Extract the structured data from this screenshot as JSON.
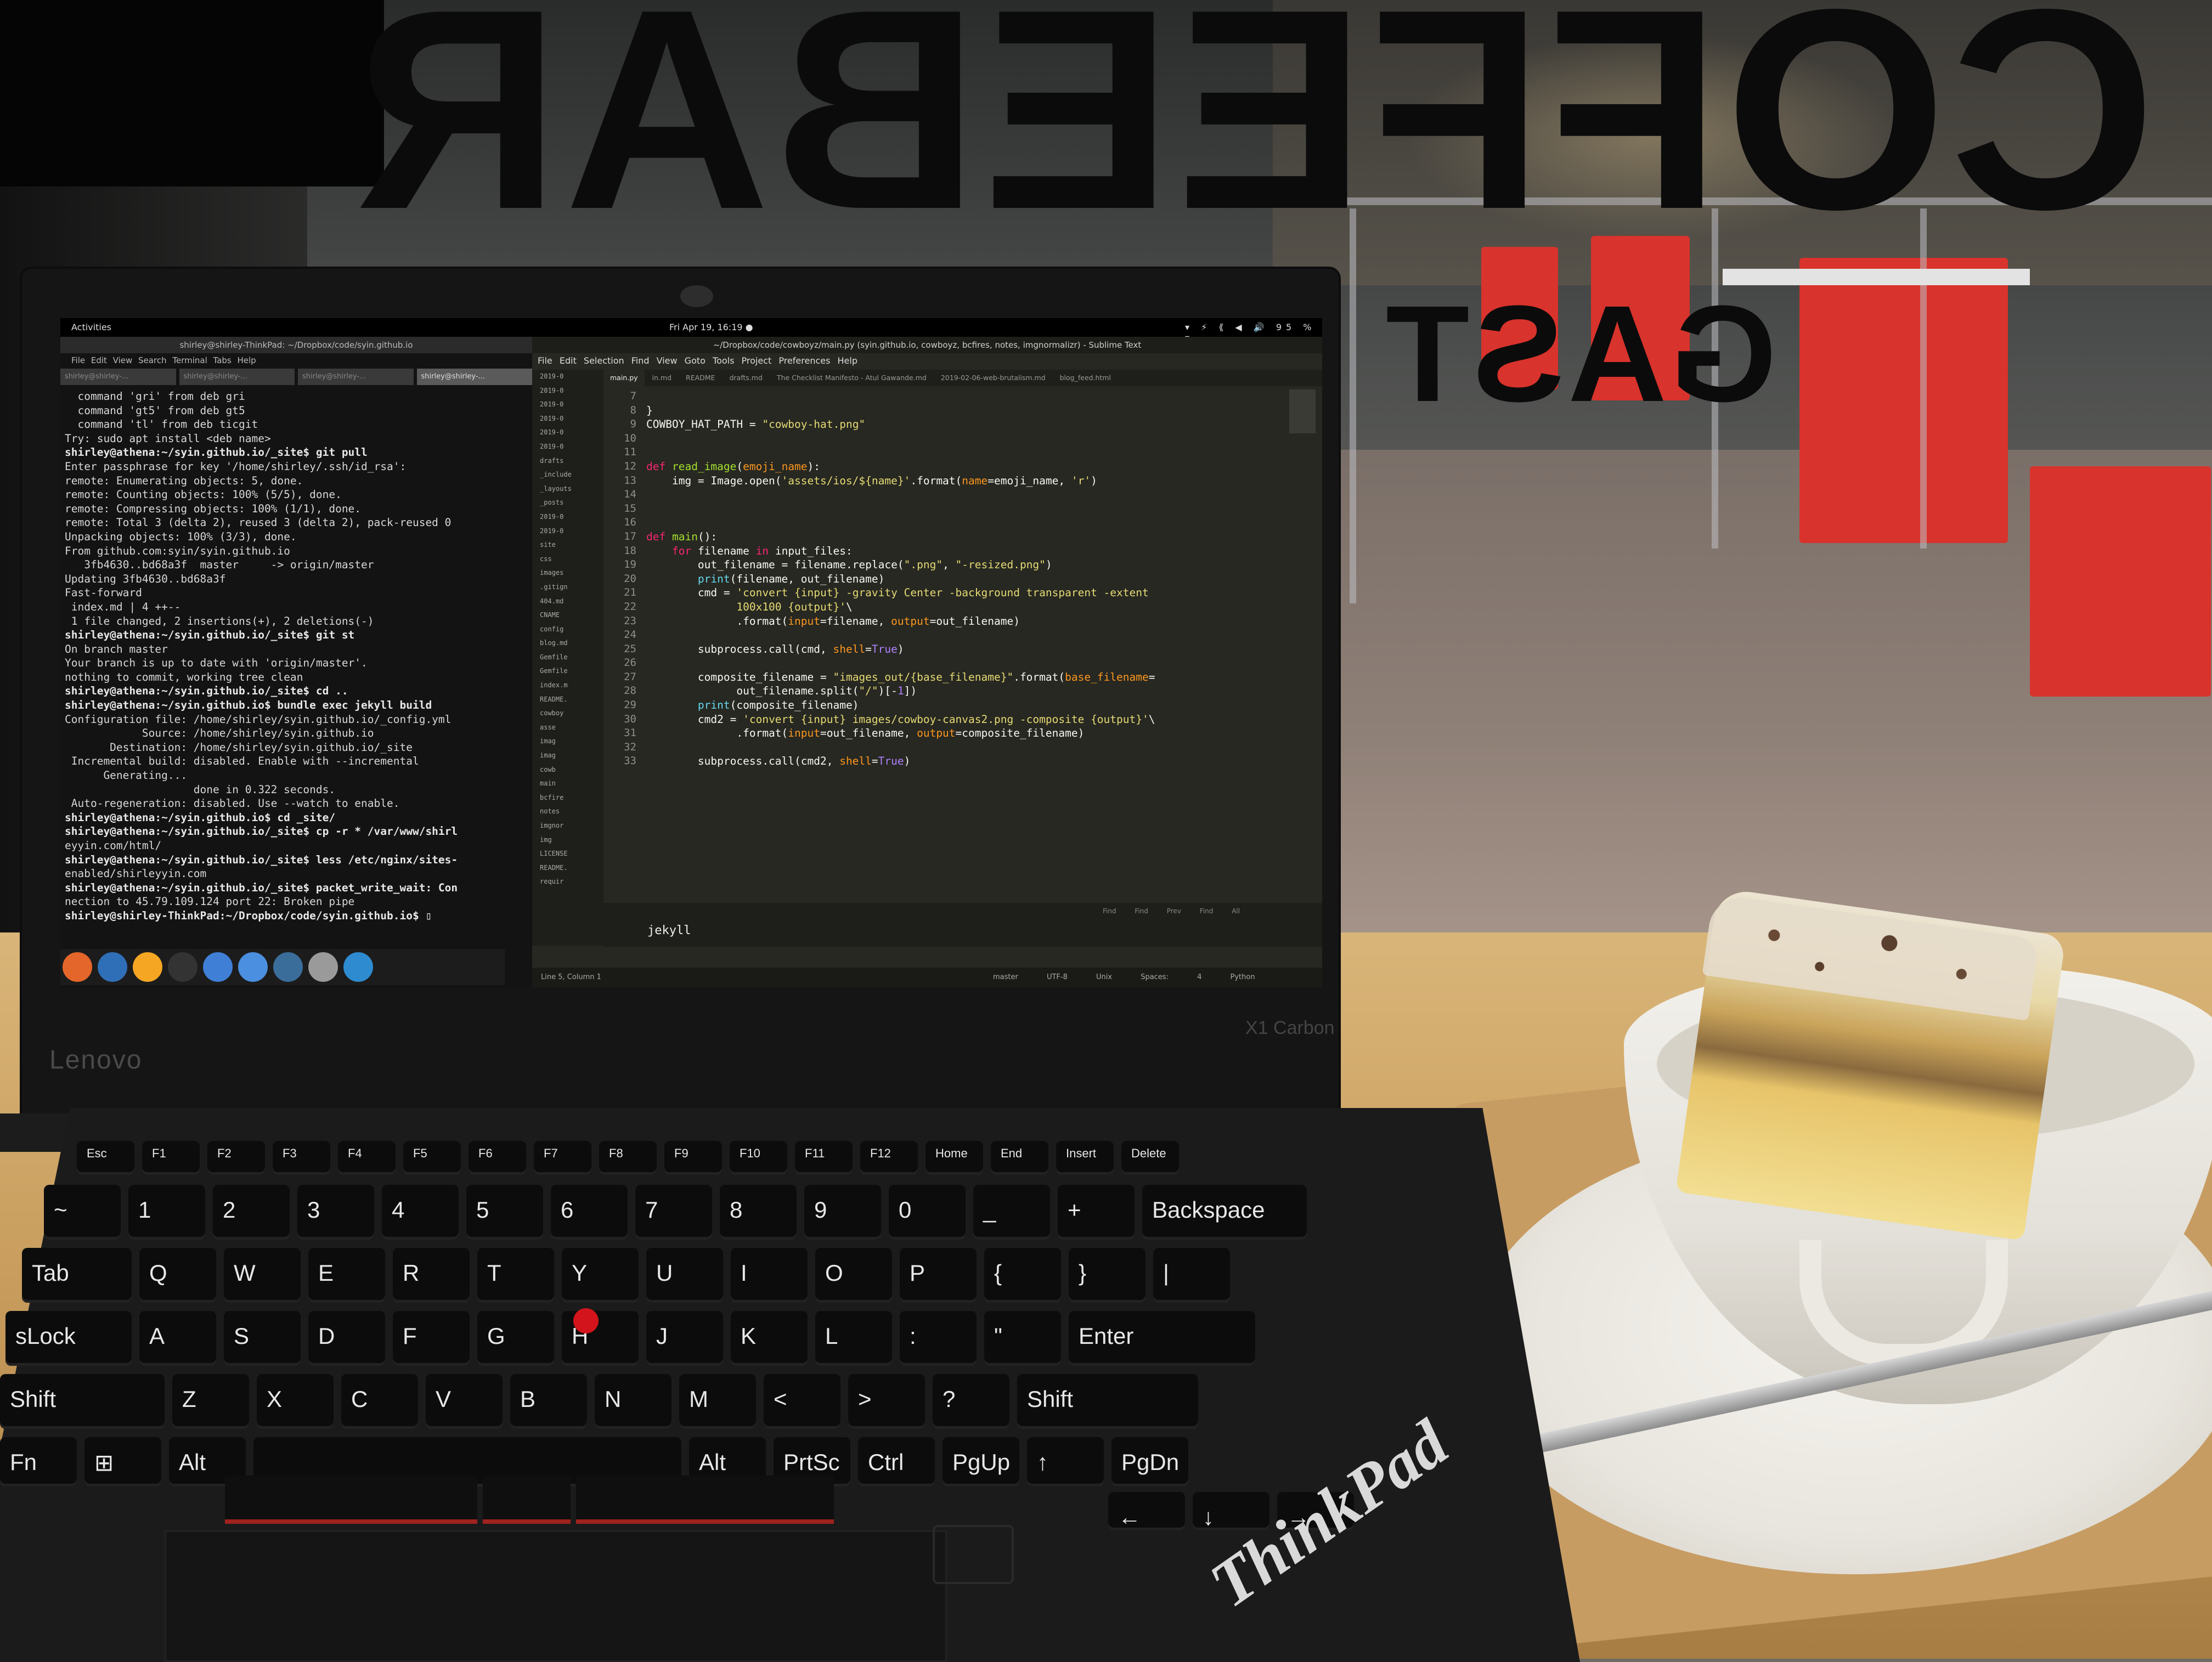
{
  "scene": {
    "window_lettering": "COFFEEBAR",
    "window_lettering_2": "GAST",
    "colors": {
      "chair": "#d8332c",
      "table": "#d1a96a",
      "trackpoint": "#d3141c"
    }
  },
  "laptop": {
    "brand": "Lenovo",
    "model": "X1 Carbon",
    "deck_logo": "ThinkPad"
  },
  "topbar": {
    "activities": "Activities",
    "clock": "Fri Apr 19, 16:19 ●",
    "tray": "▾ ⚡ ⟪ ◀ 🔊 95 % ▾"
  },
  "terminal": {
    "title": "shirley@shirley-ThinkPad: ~/Dropbox/code/syin.github.io",
    "menu": "File  Edit  View  Search  Terminal  Tabs  Help",
    "tabs": [
      "shirley@shirley-...",
      "shirley@shirley-...",
      "shirley@shirley-...",
      "shirley@shirley-..."
    ],
    "lines": [
      "  command 'gri' from deb gri",
      "  command 'gt5' from deb gt5",
      "  command 'tl' from deb ticgit",
      "",
      "Try: sudo apt install <deb name>",
      "",
      "shirley@athena:~/syin.github.io/_site$ git pull",
      "Enter passphrase for key '/home/shirley/.ssh/id_rsa':",
      "remote: Enumerating objects: 5, done.",
      "remote: Counting objects: 100% (5/5), done.",
      "remote: Compressing objects: 100% (1/1), done.",
      "remote: Total 3 (delta 2), reused 3 (delta 2), pack-reused 0",
      "Unpacking objects: 100% (3/3), done.",
      "From github.com:syin/syin.github.io",
      "   3fb4630..bd68a3f  master     -> origin/master",
      "Updating 3fb4630..bd68a3f",
      "Fast-forward",
      " index.md | 4 ++--",
      " 1 file changed, 2 insertions(+), 2 deletions(-)",
      "shirley@athena:~/syin.github.io/_site$ git st",
      "On branch master",
      "Your branch is up to date with 'origin/master'.",
      "",
      "nothing to commit, working tree clean",
      "shirley@athena:~/syin.github.io/_site$ cd ..",
      "shirley@athena:~/syin.github.io$ bundle exec jekyll build",
      "Configuration file: /home/shirley/syin.github.io/_config.yml",
      "            Source: /home/shirley/syin.github.io",
      "       Destination: /home/shirley/syin.github.io/_site",
      " Incremental build: disabled. Enable with --incremental",
      "      Generating...",
      "                    done in 0.322 seconds.",
      " Auto-regeneration: disabled. Use --watch to enable.",
      "shirley@athena:~/syin.github.io$ cd _site/",
      "shirley@athena:~/syin.github.io/_site$ cp -r * /var/www/shirl",
      "eyyin.com/html/",
      "shirley@athena:~/syin.github.io/_site$ less /etc/nginx/sites-",
      "enabled/shirleyyin.com",
      "shirley@athena:~/syin.github.io/_site$ packet_write_wait: Con",
      "nection to 45.79.109.124 port 22: Broken pipe",
      "shirley@shirley-ThinkPad:~/Dropbox/code/syin.github.io$ ▯"
    ]
  },
  "sublime": {
    "title": "~/Dropbox/code/cowboyz/main.py (syin.github.io, cowboyz, bcfires, notes, imgnormalizr) - Sublime Text",
    "menu": "File  Edit  Selection  Find  View  Goto  Tools  Project  Preferences  Help",
    "tabs": [
      "main.py",
      "in.md",
      "README",
      "drafts.md",
      "The Checklist Manifesto - Atul Gawande.md",
      "2019-02-06-web-brutalism.md",
      "blog_feed.html"
    ],
    "sidebar": [
      "2019-0",
      "2019-0",
      "2019-0",
      "2019-0",
      "2019-0",
      "2019-0",
      "drafts",
      "_include",
      "_layouts",
      "_posts",
      "2019-0",
      "2019-0",
      "site",
      "css",
      "images",
      ".gitign",
      "404.md",
      "CNAME",
      "config",
      "blog.md",
      "Gemfile",
      "Gemfile",
      "index.m",
      "README.",
      "cowboy",
      "asse",
      "imag",
      "imag",
      "cowb",
      "main",
      "bcfire",
      "notes",
      "imgnor",
      "img",
      "LICENSE",
      "README.",
      "requir"
    ],
    "line_numbers": [
      "7",
      "8",
      "9",
      "10",
      "11",
      "12",
      "13",
      "14",
      "15",
      "16",
      "17",
      "18",
      "19",
      "20",
      "21",
      "22",
      "23",
      "24",
      "25",
      "26",
      "27",
      "28",
      "29",
      "30",
      "31",
      "32",
      "33"
    ],
    "find_buttons": "Find  Find Prev  Find All",
    "find_text": "jekyll",
    "status_left": "Line 5, Column 1",
    "status_right": "master  UTF-8  Unix  Spaces: 4  Python"
  },
  "keyboard": {
    "row_fn": [
      "Esc",
      "F1",
      "F2",
      "F3",
      "F4",
      "F5",
      "F6",
      "F7",
      "F8",
      "F9",
      "F10",
      "F11",
      "F12",
      "Home",
      "End",
      "Insert",
      "Delete"
    ],
    "row_num": [
      "~",
      "1",
      "2",
      "3",
      "4",
      "5",
      "6",
      "7",
      "8",
      "9",
      "0",
      "_",
      "+",
      "Backspace"
    ],
    "row_top": [
      "Tab",
      "Q",
      "W",
      "E",
      "R",
      "T",
      "Y",
      "U",
      "I",
      "O",
      "P",
      "{",
      "}",
      "|"
    ],
    "row_home": [
      "sLock",
      "A",
      "S",
      "D",
      "F",
      "G",
      "H",
      "J",
      "K",
      "L",
      ":",
      "\"",
      "Enter"
    ],
    "row_bottom": [
      "Shift",
      "Z",
      "X",
      "C",
      "V",
      "B",
      "N",
      "M",
      "<",
      ">",
      "?",
      "Shift"
    ],
    "row_space": [
      "Fn",
      "⊞",
      "Alt",
      "",
      "Alt",
      "PrtSc",
      "Ctrl",
      "PgUp",
      "↑",
      "PgDn"
    ],
    "row_arrows": [
      "←",
      "↓",
      "→"
    ]
  }
}
